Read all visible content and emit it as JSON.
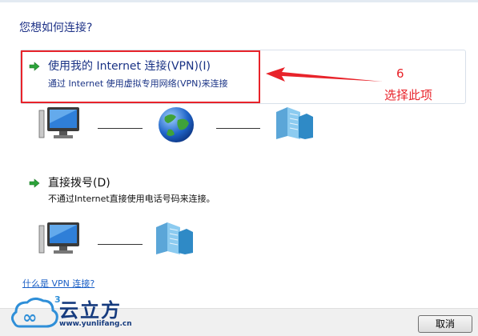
{
  "dialog": {
    "question": "您想如何连接?"
  },
  "options": [
    {
      "title": "使用我的 Internet 连接(VPN)(I)",
      "desc": "通过 Internet 使用虚拟专用网络(VPN)来连接"
    },
    {
      "title": "直接拨号(D)",
      "desc": "不通过Internet直接使用电话号码来连接。"
    }
  ],
  "annotation": {
    "number": "6",
    "text": "选择此项"
  },
  "links": {
    "help": "什么是 VPN 连接?"
  },
  "buttons": {
    "cancel": "取消"
  },
  "watermark": {
    "name": "云立方",
    "url": "www.yunlifang.cn",
    "badge": "3"
  },
  "colors": {
    "title_blue": "#1a3385",
    "annotation_red": "#e8232a"
  },
  "icons": [
    "arrow-right-icon",
    "computer-icon",
    "globe-icon",
    "server-icon"
  ]
}
